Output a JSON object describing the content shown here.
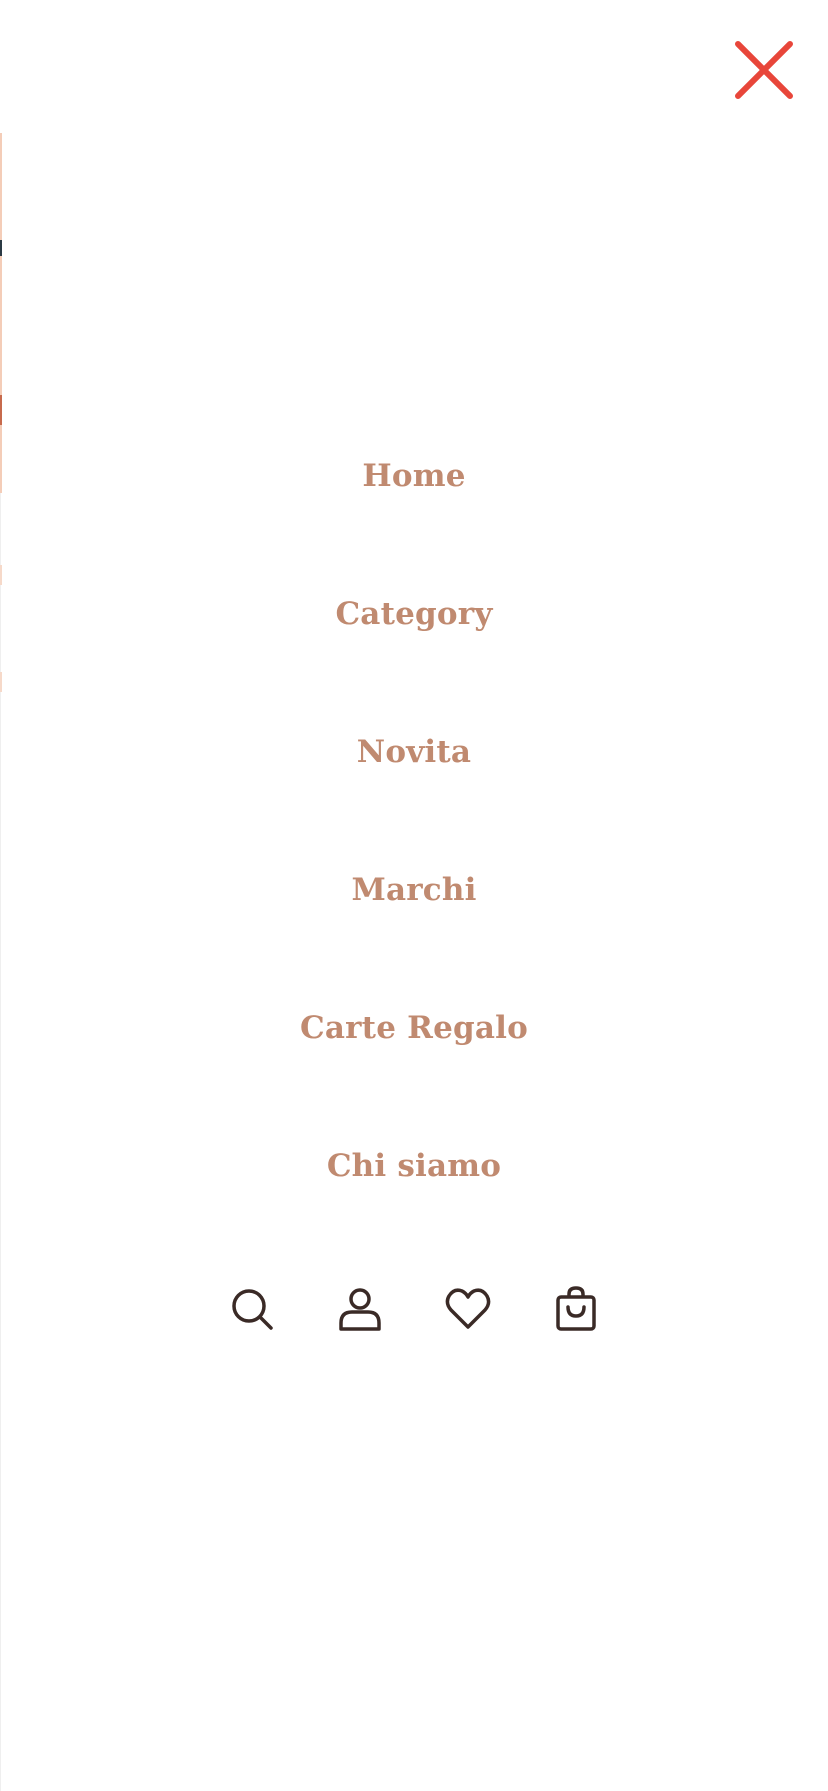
{
  "header": {
    "close_icon": "close-icon",
    "close_color": "#e8463a"
  },
  "menu": {
    "items": [
      {
        "label": "Home"
      },
      {
        "label": "Category"
      },
      {
        "label": "Novita"
      },
      {
        "label": "Marchi"
      },
      {
        "label": "Carte Regalo"
      },
      {
        "label": "Chi siamo"
      }
    ],
    "text_color": "#c08a70"
  },
  "actions": {
    "icons": [
      "search-icon",
      "account-icon",
      "wishlist-heart-icon",
      "cart-bag-icon"
    ],
    "icon_color": "#3a2a26"
  }
}
